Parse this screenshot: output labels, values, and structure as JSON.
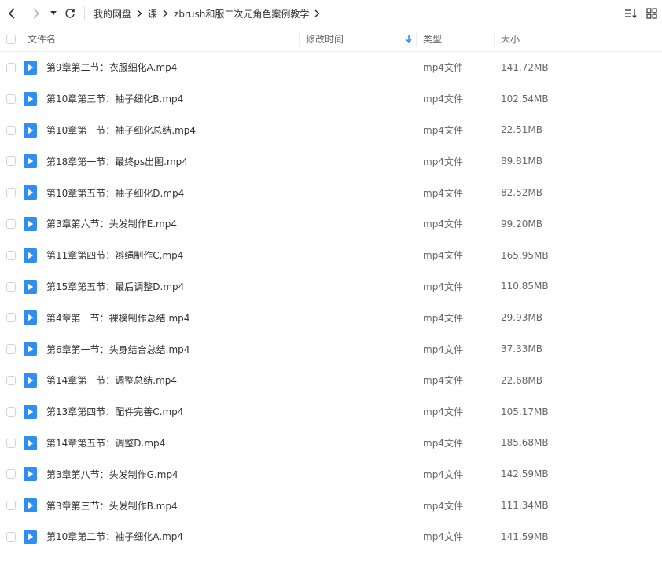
{
  "breadcrumb": {
    "items": [
      "我的网盘",
      "课",
      "zbrush和服二次元角色案例教学"
    ]
  },
  "columns": {
    "name": "文件名",
    "modified": "修改时间",
    "type": "类型",
    "size": "大小"
  },
  "colors": {
    "accent": "#2e8ff0",
    "sort_arrow": "#2e8ff0"
  },
  "files": [
    {
      "name": "第9章第二节：衣服细化A.mp4",
      "type": "mp4文件",
      "size": "141.72MB"
    },
    {
      "name": "第10章第三节：袖子细化B.mp4",
      "type": "mp4文件",
      "size": "102.54MB"
    },
    {
      "name": "第10章第一节：袖子细化总结.mp4",
      "type": "mp4文件",
      "size": "22.51MB"
    },
    {
      "name": "第18章第一节：最终ps出图.mp4",
      "type": "mp4文件",
      "size": "89.81MB"
    },
    {
      "name": "第10章第五节：袖子细化D.mp4",
      "type": "mp4文件",
      "size": "82.52MB"
    },
    {
      "name": "第3章第六节：头发制作E.mp4",
      "type": "mp4文件",
      "size": "99.20MB"
    },
    {
      "name": "第11章第四节：辫绳制作C.mp4",
      "type": "mp4文件",
      "size": "165.95MB"
    },
    {
      "name": "第15章第五节：最后调整D.mp4",
      "type": "mp4文件",
      "size": "110.85MB"
    },
    {
      "name": "第4章第一节：裸模制作总结.mp4",
      "type": "mp4文件",
      "size": "29.93MB"
    },
    {
      "name": "第6章第一节：头身结合总结.mp4",
      "type": "mp4文件",
      "size": "37.33MB"
    },
    {
      "name": "第14章第一节：调整总结.mp4",
      "type": "mp4文件",
      "size": "22.68MB"
    },
    {
      "name": "第13章第四节：配件完善C.mp4",
      "type": "mp4文件",
      "size": "105.17MB"
    },
    {
      "name": "第14章第五节：调整D.mp4",
      "type": "mp4文件",
      "size": "185.68MB"
    },
    {
      "name": "第3章第八节：头发制作G.mp4",
      "type": "mp4文件",
      "size": "142.59MB"
    },
    {
      "name": "第3章第三节：头发制作B.mp4",
      "type": "mp4文件",
      "size": "111.34MB"
    },
    {
      "name": "第10章第二节：袖子细化A.mp4",
      "type": "mp4文件",
      "size": "141.59MB"
    }
  ]
}
